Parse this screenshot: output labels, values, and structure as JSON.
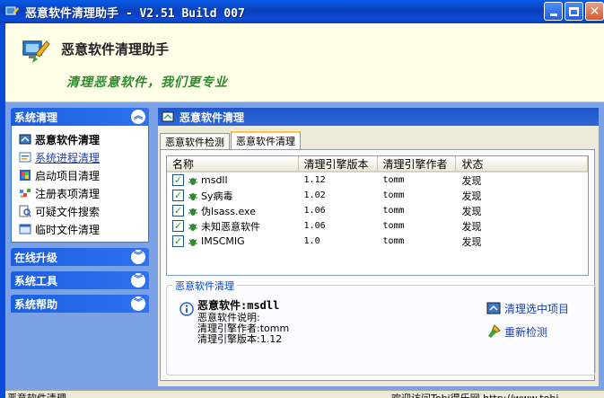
{
  "window": {
    "title": "恶意软件清理助手 - V2.51 Build 007"
  },
  "banner": {
    "app_name": "恶意软件清理助手",
    "slogan": "清理恶意软件，我们更专业"
  },
  "nav": {
    "sections": [
      {
        "title": "系统清理",
        "expanded": true,
        "items": [
          {
            "label": "恶意软件清理",
            "icon": "cleaner-icon"
          },
          {
            "label": "系统进程清理",
            "icon": "process-icon"
          },
          {
            "label": "启动项目清理",
            "icon": "startup-icon"
          },
          {
            "label": "注册表项清理",
            "icon": "registry-icon"
          },
          {
            "label": "可疑文件搜索",
            "icon": "search-file-icon"
          },
          {
            "label": "临时文件清理",
            "icon": "temp-file-icon"
          }
        ]
      },
      {
        "title": "在线升级",
        "expanded": false
      },
      {
        "title": "系统工具",
        "expanded": false
      },
      {
        "title": "系统帮助",
        "expanded": false
      }
    ]
  },
  "main": {
    "header": "恶意软件清理",
    "tabs": [
      {
        "label": "恶意软件检测"
      },
      {
        "label": "恶意软件清理"
      }
    ],
    "list": {
      "columns": [
        "名称",
        "清理引擎版本",
        "清理引擎作者",
        "状态"
      ],
      "rows": [
        {
          "name": "msdll",
          "version": "1.12",
          "author": "tomm",
          "status": "发现"
        },
        {
          "name": "Sy病毒",
          "version": "1.02",
          "author": "tomm",
          "status": "发现"
        },
        {
          "name": "伪lsass.exe",
          "version": "1.06",
          "author": "tomm",
          "status": "发现"
        },
        {
          "name": "未知恶意软件",
          "version": "1.06",
          "author": "tomm",
          "status": "发现"
        },
        {
          "name": "IMSCMIG",
          "version": "1.0",
          "author": "tomm",
          "status": "发现"
        }
      ]
    },
    "detail": {
      "legend": "恶意软件清理",
      "title": "恶意软件:msdll",
      "desc": "恶意软件说明:",
      "author": "清理引擎作者:tomm",
      "version": "清理引擎版本:1.12",
      "clean_selected": "清理选中项目",
      "rescan": "重新检测"
    }
  },
  "status": {
    "left": "恶意软件清理",
    "right": "欢迎访问Tobi得乐网 http://www.tobi"
  },
  "colors": {
    "titlebar": "#0A3FB8",
    "nav_bg": "#7BA2E7",
    "banner_bg": "#FFFFE8",
    "slogan": "#2E8B2E"
  }
}
